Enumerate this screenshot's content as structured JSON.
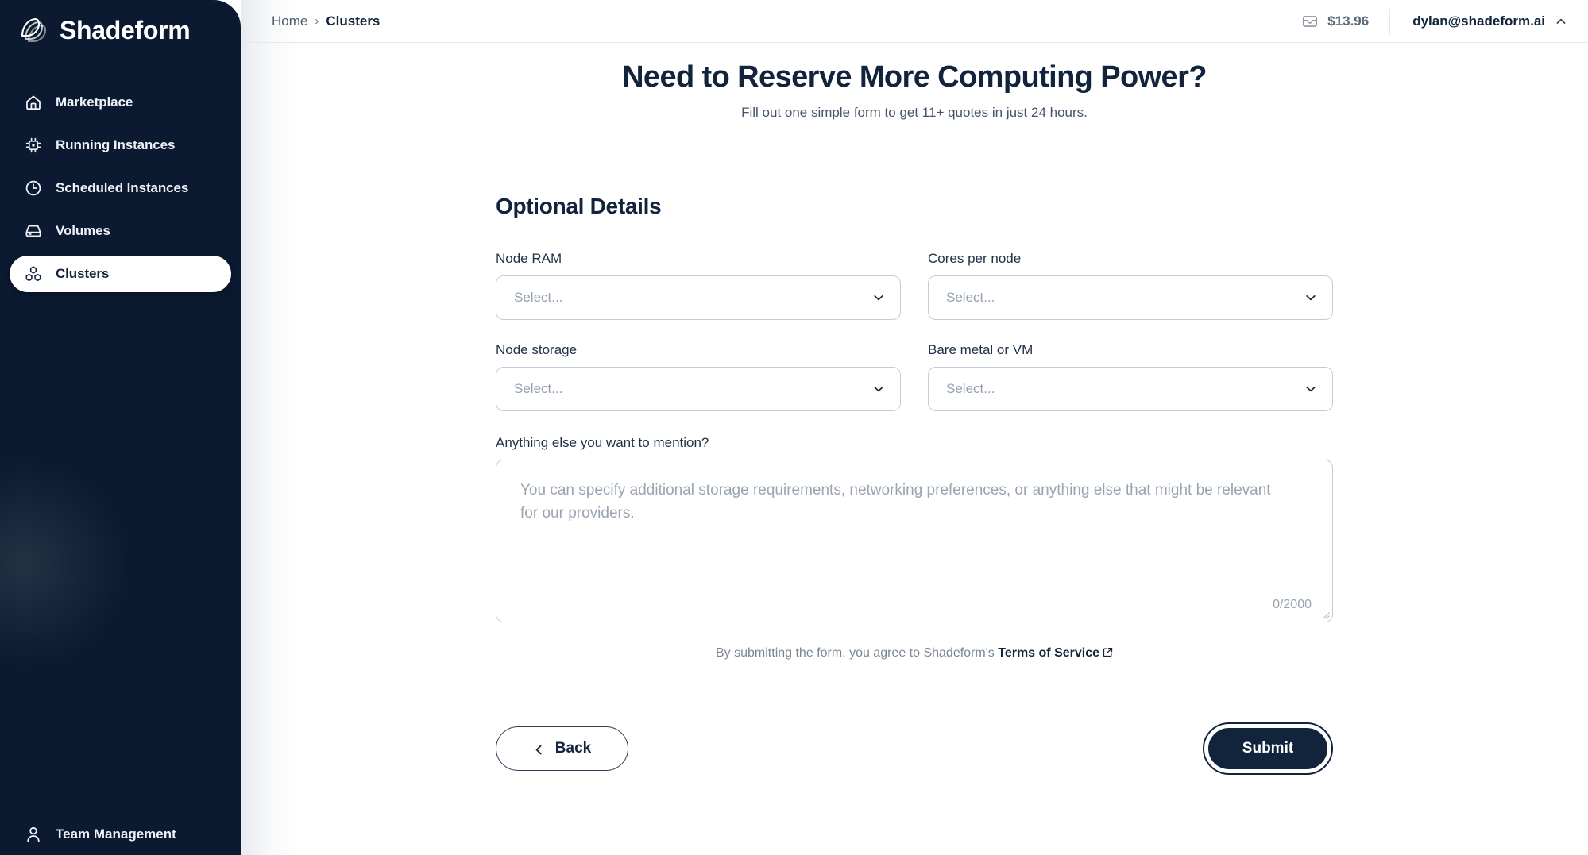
{
  "sidebar": {
    "brand": {
      "name": "Shadeform",
      "logo_icon": "shadeform-logo-icon"
    },
    "items": [
      {
        "label": "Marketplace",
        "icon": "home-icon",
        "active": false
      },
      {
        "label": "Running Instances",
        "icon": "cpu-chip-icon",
        "active": false
      },
      {
        "label": "Scheduled Instances",
        "icon": "clock-icon",
        "active": false
      },
      {
        "label": "Volumes",
        "icon": "hard-drive-icon",
        "active": false
      },
      {
        "label": "Clusters",
        "icon": "cubes-icon",
        "active": true
      }
    ],
    "bottom_item": {
      "label": "Team Management",
      "icon": "user-icon"
    }
  },
  "topbar": {
    "breadcrumb": {
      "home": "Home",
      "separator": "›",
      "current": "Clusters"
    },
    "balance": {
      "icon": "wallet-icon",
      "amount": "$13.96"
    },
    "account": {
      "email": "dylan@shadeform.ai",
      "caret_icon": "chevron-up-icon"
    }
  },
  "page": {
    "title": "Need to Reserve More Computing Power?",
    "subtitle": "Fill out one simple form to get 11+ quotes in just 24 hours.",
    "section_title": "Optional Details"
  },
  "form": {
    "fields": [
      {
        "label": "Node RAM",
        "value": "Select...",
        "name": "node-ram"
      },
      {
        "label": "Cores per node",
        "value": "Select...",
        "name": "cores-per-node"
      },
      {
        "label": "Node storage",
        "value": "Select...",
        "name": "node-storage"
      },
      {
        "label": "Bare metal or VM",
        "value": "Select...",
        "name": "bare-metal-or-vm"
      }
    ],
    "textarea": {
      "label": "Anything else you want to mention?",
      "placeholder": "You can specify additional storage requirements, networking preferences, or anything else that might be relevant for our providers.",
      "value": "",
      "counter": "0/2000"
    },
    "terms": {
      "prefix": "By submitting the form, you agree to Shadeform's ",
      "link": "Terms of Service",
      "external_icon": "external-link-icon"
    },
    "buttons": {
      "back": {
        "label": "Back",
        "icon": "chevron-left-icon"
      },
      "submit": {
        "label": "Submit",
        "focused": true
      }
    }
  },
  "colors": {
    "sidebar_bg": "#0b1a30",
    "brand_dark": "#11243c",
    "text_muted": "#7b8694",
    "border": "#c6ccd6",
    "placeholder": "#95a0b0"
  }
}
